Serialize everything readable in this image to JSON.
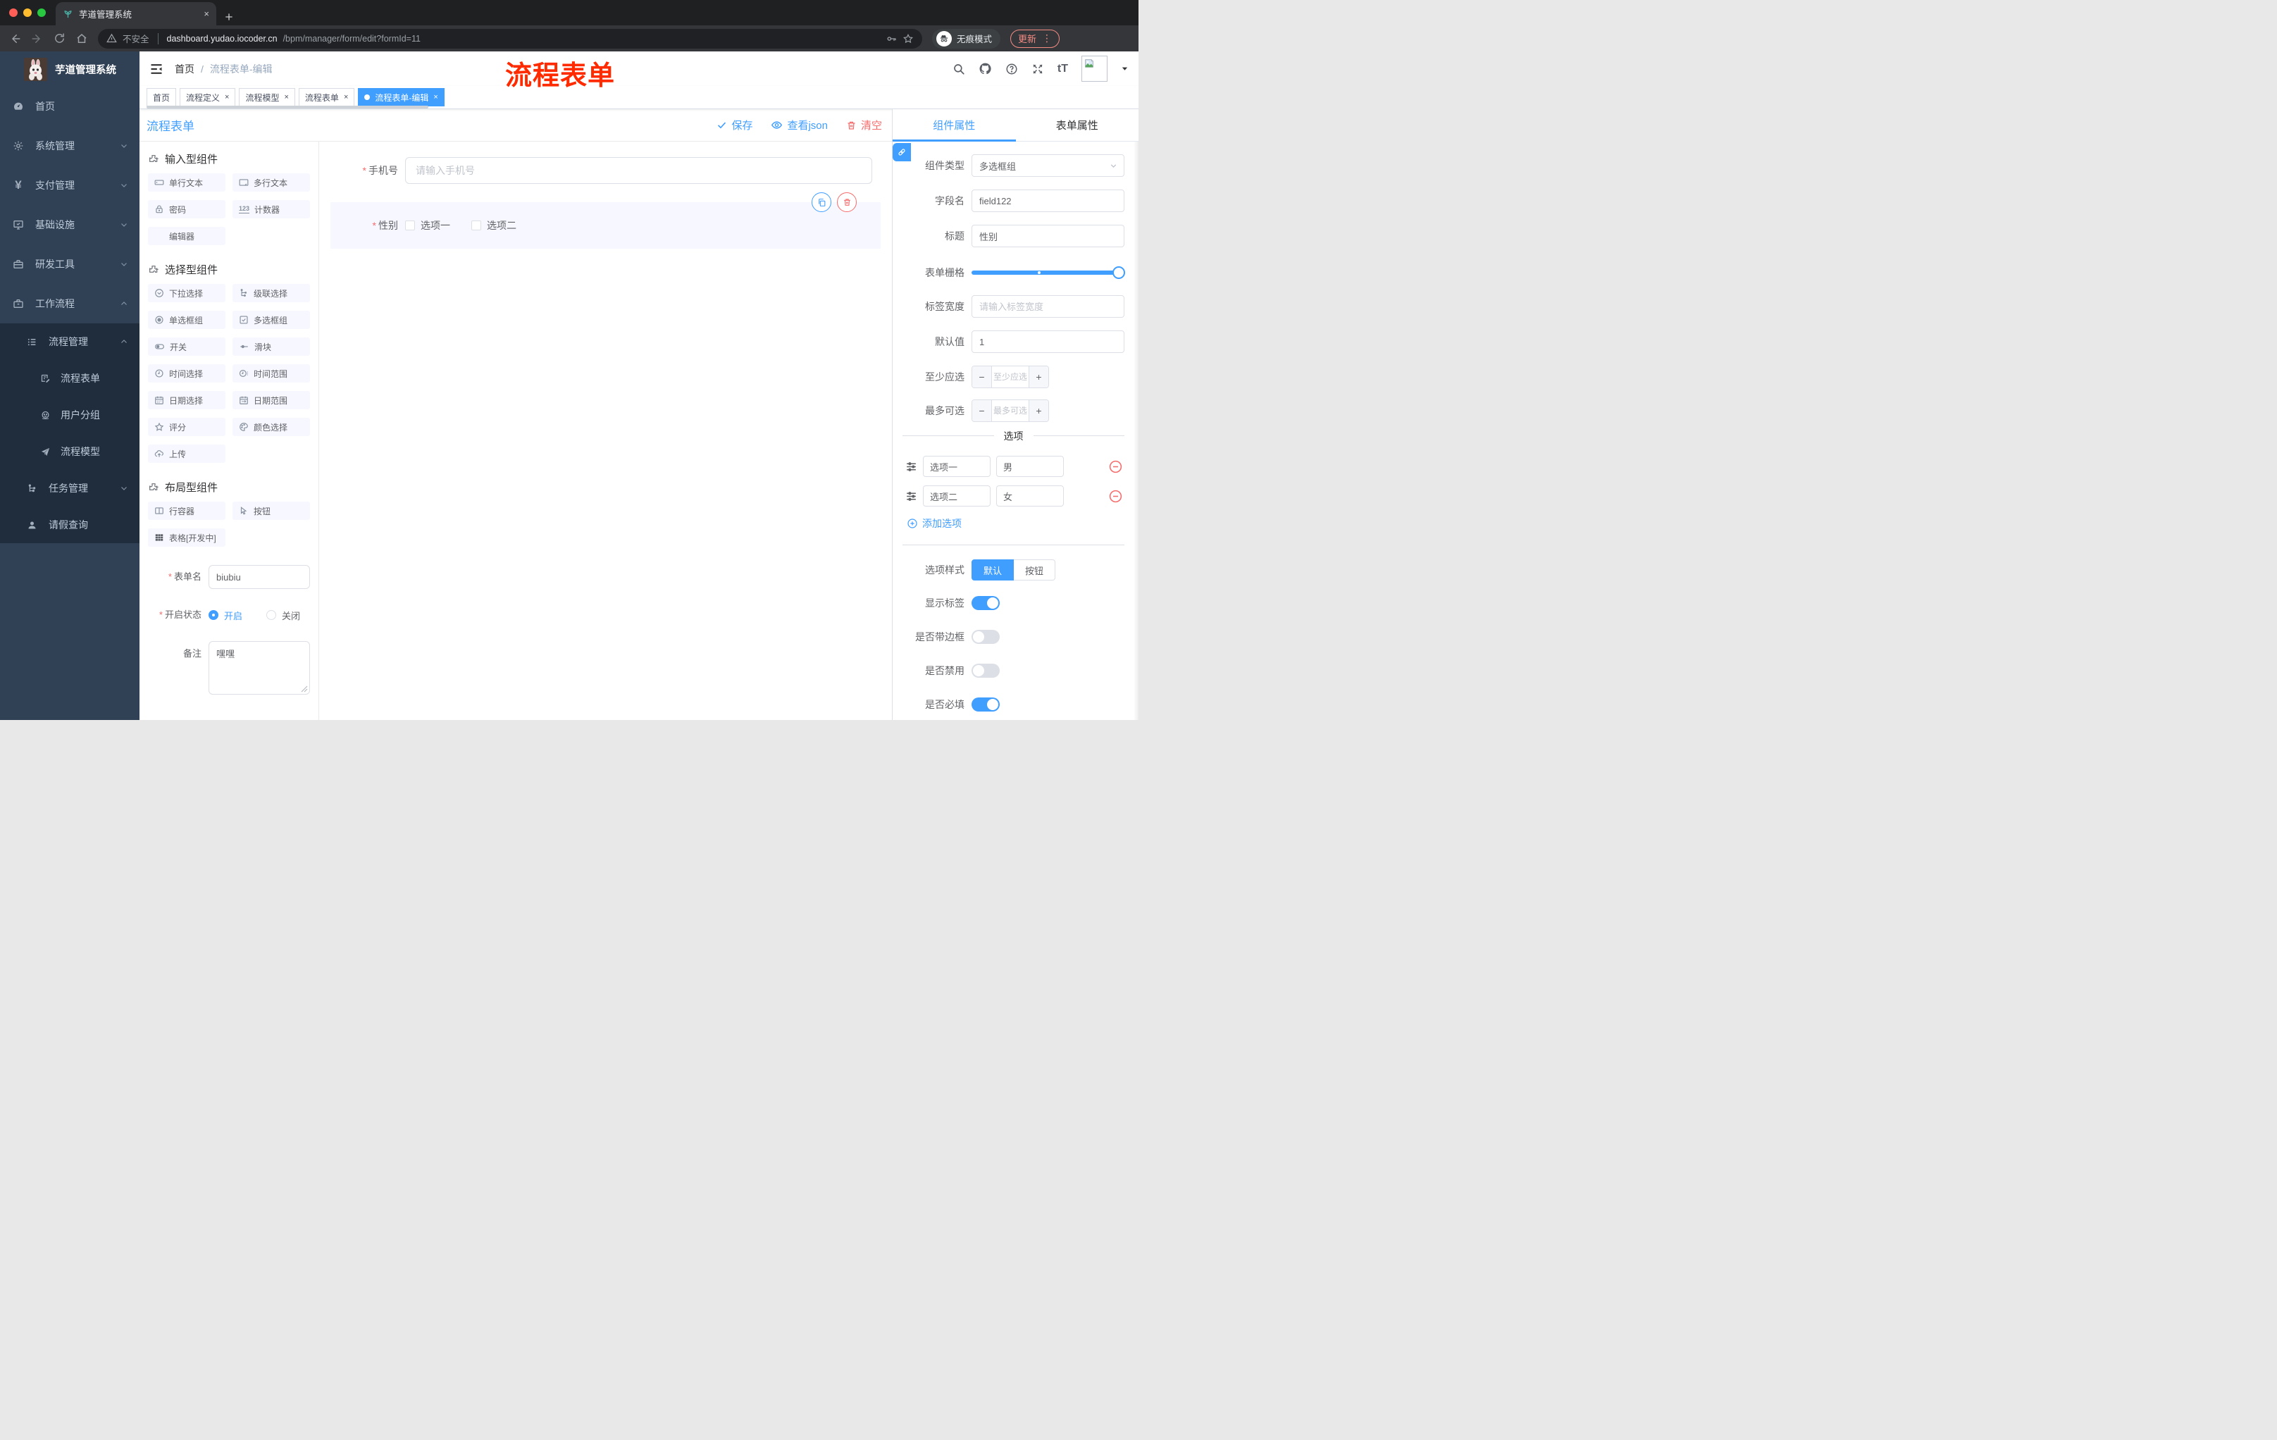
{
  "ui": {
    "required_mark": "*"
  },
  "icons": {
    "counter_glyph": "123",
    "text_size_glyph": "tT",
    "yen_glyph": "¥",
    "kebab_glyph": "⋮",
    "close_glyph": "×",
    "plus_glyph": "+",
    "minus_glyph": "−"
  },
  "browser": {
    "tab_title": "芋道管理系统",
    "security_label": "不安全",
    "url_host": "dashboard.yudao.iocoder.cn",
    "url_path": "/bpm/manager/form/edit?formId=11",
    "incognito_label": "无痕模式",
    "update_label": "更新"
  },
  "sidebar": {
    "logo_title": "芋道管理系统",
    "items": [
      "首页",
      "系统管理",
      "支付管理",
      "基础设施",
      "研发工具",
      "工作流程"
    ],
    "sub_items": [
      "流程管理",
      "流程表单",
      "用户分组",
      "流程模型",
      "任务管理",
      "请假查询"
    ]
  },
  "header": {
    "breadcrumb_home": "首页",
    "breadcrumb_sep": "/",
    "breadcrumb_current": "流程表单-编辑",
    "annotation": "流程表单"
  },
  "tags": [
    {
      "label": "首页"
    },
    {
      "label": "流程定义"
    },
    {
      "label": "流程模型"
    },
    {
      "label": "流程表单"
    },
    {
      "label": "流程表单-编辑"
    }
  ],
  "designer": {
    "title": "流程表单",
    "save_label": "保存",
    "view_json_label": "查看json",
    "clear_label": "清空"
  },
  "palette": {
    "sections": [
      {
        "title": "输入型组件",
        "items": [
          "单行文本",
          "多行文本",
          "密码",
          "计数器",
          "编辑器"
        ]
      },
      {
        "title": "选择型组件",
        "items": [
          "下拉选择",
          "级联选择",
          "单选框组",
          "多选框组",
          "开关",
          "滑块",
          "时间选择",
          "时间范围",
          "日期选择",
          "日期范围",
          "评分",
          "颜色选择",
          "上传"
        ]
      },
      {
        "title": "布局型组件",
        "items": [
          "行容器",
          "按钮",
          "表格[开发中]"
        ]
      }
    ]
  },
  "meta_form": {
    "name_label": "表单名",
    "name_value": "biubiu",
    "status_label": "开启状态",
    "status_on": "开启",
    "status_off": "关闭",
    "remark_label": "备注",
    "remark_value": "嘿嘿"
  },
  "canvas": {
    "phone_label": "手机号",
    "phone_placeholder": "请输入手机号",
    "gender_label": "性别",
    "gender_options": [
      "选项一",
      "选项二"
    ]
  },
  "props": {
    "tab_component": "组件属性",
    "tab_form": "表单属性",
    "type_label": "组件类型",
    "type_value": "多选框组",
    "field_label": "字段名",
    "field_value": "field122",
    "title_label": "标题",
    "title_value": "性别",
    "grid_label": "表单栅格",
    "label_width_label": "标签宽度",
    "label_width_placeholder": "请输入标签宽度",
    "default_label": "默认值",
    "default_value": "1",
    "min_label": "至少应选",
    "min_placeholder": "至少应选",
    "max_label": "最多可选",
    "max_placeholder": "最多可选",
    "options_title": "选项",
    "options": [
      {
        "label": "选项一",
        "value": "男"
      },
      {
        "label": "选项二",
        "value": "女"
      }
    ],
    "add_option_label": "添加选项",
    "style_label": "选项样式",
    "style_options": [
      "默认",
      "按钮"
    ],
    "style_selected": "默认",
    "toggles": [
      {
        "label": "显示标签",
        "on": true
      },
      {
        "label": "是否带边框",
        "on": false
      },
      {
        "label": "是否禁用",
        "on": false
      },
      {
        "label": "是否必填",
        "on": true
      }
    ]
  },
  "colors": {
    "primary": "#409EFF",
    "danger": "#F56C6C",
    "tag_active": "#409EFF",
    "sidebar_bg": "#304156",
    "submenu_bg": "#1F2D3D",
    "annotation_red": "#FF2B00",
    "palette_item_bg": "#F6F7FF",
    "selected_block_bg": "#F6F7FF"
  }
}
